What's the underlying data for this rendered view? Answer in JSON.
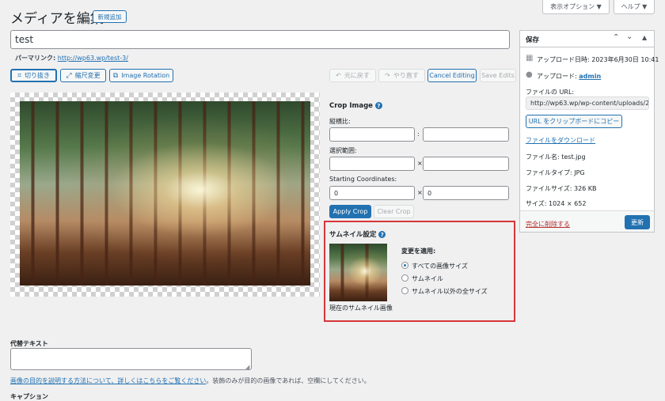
{
  "header": {
    "title": "メディアを編集",
    "new_button": "新規追加",
    "screen_options": "表示オプション ▼",
    "help": "ヘルプ ▼"
  },
  "post": {
    "title_value": "test",
    "permalink_label": "パーマリンク:",
    "permalink_url": "http://wp63.wp/test-3/"
  },
  "toolbar": {
    "crop": "切り抜き",
    "scale": "縮尺変更",
    "rotation": "Image Rotation",
    "undo": "元に戻す",
    "redo": "やり直す",
    "cancel": "Cancel Editing",
    "save": "Save Edits"
  },
  "crop_panel": {
    "title": "Crop Image",
    "aspect_label": "縦横比:",
    "aspect_sep": ":",
    "selection_label": "選択範囲:",
    "selection_sep": "×",
    "coords_label": "Starting Coordinates:",
    "coord_x": "0",
    "coord_sep": "×",
    "coord_y": "0",
    "apply": "Apply Crop",
    "clear": "Clear Crop"
  },
  "thumb_panel": {
    "title": "サムネイル設定",
    "apply_label": "変更を適用:",
    "options": [
      "すべての画像サイズ",
      "サムネイル",
      "サムネイル以外の全サイズ"
    ],
    "selected_index": 0,
    "current_caption": "現在のサムネイル画像"
  },
  "sidebar": {
    "box_title": "保存",
    "upload_date": "アップロード日時: 2023年6月30日 10:41",
    "uploader_label": "アップロード: ",
    "uploader_name": "admin",
    "file_url_label": "ファイルの URL:",
    "file_url_value": "http://wp63.wp/wp-content/uploads/2",
    "copy_button": "URL をクリップボードにコピー",
    "download_link": "ファイルをダウンロード",
    "file_name": "ファイル名: test.jpg",
    "file_type": "ファイルタイプ: JPG",
    "file_size": "ファイルサイズ: 326 KB",
    "dimensions": "サイズ: 1024 × 652",
    "delete_link": "完全に削除する",
    "update_button": "更新"
  },
  "alt_text": {
    "label": "代替テキスト",
    "help_link": "画像の目的を説明する方法について、詳しくはこちらをご覧ください",
    "help_rest": "。装飾のみが目的の画像であれば、空欄にしてください。"
  },
  "caption": {
    "label": "キャプション"
  },
  "colors": {
    "accent": "#2271b1",
    "highlight_box": "#d63638",
    "delete": "#b32d2e"
  }
}
